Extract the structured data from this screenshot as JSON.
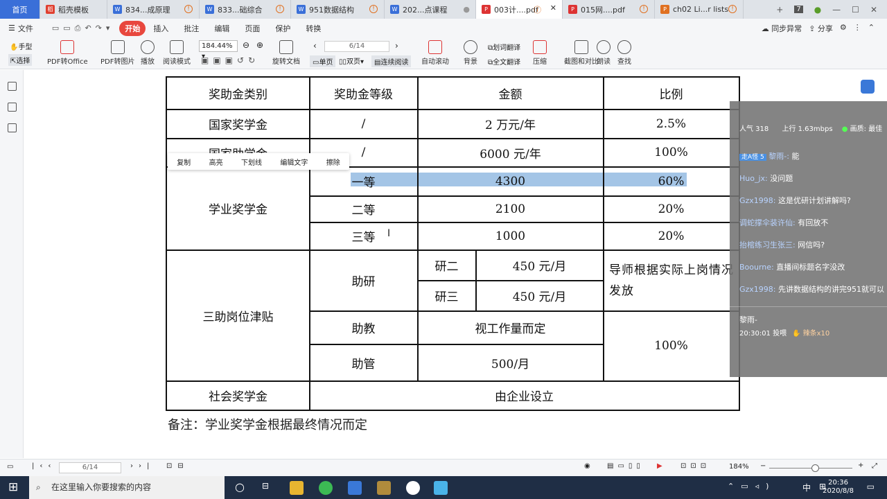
{
  "tabs": [
    {
      "label": "首页",
      "icon": "home"
    },
    {
      "label": "稻壳模板",
      "icon": "docer-icon",
      "color": "#e04030"
    },
    {
      "label": "834...成原理",
      "icon": "word-icon",
      "color": "#3a6fd8"
    },
    {
      "label": "833...础综合",
      "icon": "word-icon",
      "color": "#3a6fd8"
    },
    {
      "label": "951数据结构",
      "icon": "word-icon",
      "color": "#3a6fd8"
    },
    {
      "label": "202...点课程",
      "icon": "word-icon",
      "color": "#3a6fd8"
    },
    {
      "label": "003计....pdf",
      "icon": "pdf-icon",
      "color": "#d33"
    },
    {
      "label": "015网....pdf",
      "icon": "pdf-icon",
      "color": "#d33"
    },
    {
      "label": "ch02 Li...r lists",
      "icon": "ppt-icon",
      "color": "#e07020"
    }
  ],
  "window": {
    "tab_count": "7"
  },
  "menu": {
    "file": "文件",
    "items": [
      "开始",
      "插入",
      "批注",
      "编辑",
      "页面",
      "保护",
      "转换"
    ],
    "sync": "同步异常",
    "share": "分享"
  },
  "toolbar": {
    "hand": "手型",
    "select": "选择",
    "pdf_to_office": "PDF转Office",
    "pdf_to_image": "PDF转图片",
    "play": "播放",
    "read_mode": "阅读模式",
    "zoom": "184.44%",
    "page": "6/14",
    "rotate": "旋转文档",
    "single": "单页",
    "double": "双页",
    "continuous": "连续阅读",
    "auto_scroll": "自动滚动",
    "background": "背景",
    "word_translate": "划词翻译",
    "full_translate": "全文翻译",
    "compress": "压缩",
    "screenshot": "截图和对比",
    "read_aloud": "朗读",
    "find": "查找"
  },
  "table": {
    "headers": [
      "奖助金类别",
      "奖助金等级",
      "金额",
      "比例"
    ],
    "national_scholarship": {
      "category": "国家奖学金",
      "level": "/",
      "amount": "2 万元/年",
      "ratio": "2.5%"
    },
    "national_grant": {
      "category": "国家助学金",
      "level": "/",
      "amount": "6000 元/年",
      "ratio": "100%"
    },
    "academic": {
      "category": "学业奖学金",
      "rows": [
        {
          "level": "一等",
          "amount": "4300",
          "ratio": "60%"
        },
        {
          "level": "二等",
          "amount": "2100",
          "ratio": "20%"
        },
        {
          "level": "三等",
          "amount": "1000",
          "ratio": "20%"
        }
      ]
    },
    "assistant": {
      "category": "三助岗位津贴",
      "research": "助研",
      "research_rows": [
        {
          "grade": "研二",
          "amount": "450 元/月"
        },
        {
          "grade": "研三",
          "amount": "450 元/月"
        }
      ],
      "research_ratio": "导师根据实际上岗情况发放",
      "teaching": "助教",
      "teaching_amount": "视工作量而定",
      "management": "助管",
      "management_amount": "500/月",
      "ratio": "100%"
    },
    "social": {
      "category": "社会奖学金",
      "amount": "由企业设立"
    }
  },
  "note": "备注：学业奖学金根据最终情况而定",
  "popup": [
    "复制",
    "高亮",
    "下划线",
    "编辑文字",
    "擦除"
  ],
  "chat": {
    "stats": {
      "popularity": "人气  318",
      "upload": "上行  1.63mbps",
      "quality": "画质: 最佳"
    },
    "messages": [
      {
        "badge": "走A怪 5",
        "user": "黎雨-:",
        "text": "能"
      },
      {
        "user": "Huo_jx:",
        "text": "没问题"
      },
      {
        "user": "Gzx1998:",
        "text": "这是优研计划讲解吗?"
      },
      {
        "user": "调蛇撑伞装许仙:",
        "text": "有回放不"
      },
      {
        "user": "抬棺练习生张三:",
        "text": "网信吗?"
      },
      {
        "user": "Boourne:",
        "text": "直播间标题名字没改"
      },
      {
        "user": "Gzx1998:",
        "text": "先讲数据结构的讲完951就可以"
      }
    ],
    "gift_user": "黎雨-",
    "gift_time": "20:30:01 投喂",
    "gift": "辣条x10"
  },
  "status": {
    "page": "6/14",
    "zoom": "184%"
  },
  "taskbar": {
    "search_placeholder": "在这里输入你要搜索的内容",
    "time": "20:36",
    "date": "2020/8/8",
    "ime": "中"
  }
}
